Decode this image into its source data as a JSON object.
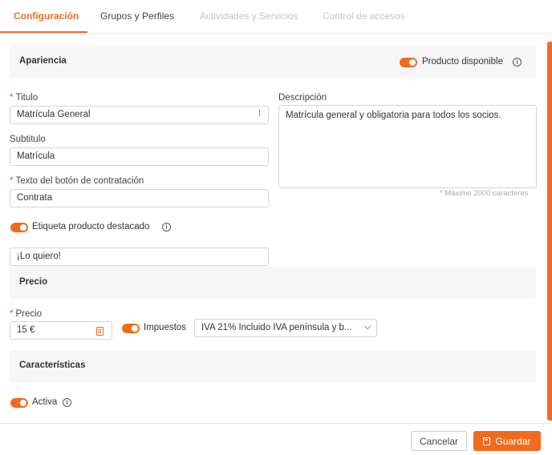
{
  "tabs": [
    {
      "label": "Configuración"
    },
    {
      "label": "Grupos y Perfiles"
    },
    {
      "label": "Actividades y Servicios"
    },
    {
      "label": "Control de accesos"
    }
  ],
  "apariencia": {
    "title": "Apariencia",
    "available_label": "Producto disponible",
    "available_on": true
  },
  "form": {
    "required_mark": "*",
    "titulo_label": "Titulo",
    "titulo_value": "Matrícula General",
    "descripcion_label": "Descripción",
    "descripcion_value": "Matrícula general y obligatoria para todos los socios.",
    "descripcion_hint": "* Máximo 2000 caracteres",
    "subtitulo_label": "Subtitulo",
    "subtitulo_value": "Matrícula",
    "boton_label": "Texto del botón de contratación",
    "boton_value": "Contrata",
    "destacado_label": "Etiqueta producto destacado",
    "destacado_on": true,
    "destacado_value": "¡Lo quiero!"
  },
  "precio": {
    "title": "Precio",
    "label": "Precio",
    "value": "15 €",
    "impuestos_label": "Impuestos",
    "impuestos_on": true,
    "impuestos_value": "IVA 21% Incluido IVA península y b..."
  },
  "caracteristicas": {
    "title": "Características",
    "activa_label": "Activa",
    "activa_on": true
  },
  "footer": {
    "cancel_label": "Cancelar",
    "save_label": "Guardar"
  },
  "colors": {
    "accent": "#f26b1d",
    "required": "#e14a3b"
  },
  "icons": {
    "info": "info-icon",
    "copy": "document-icon",
    "save": "save-icon",
    "chevron": "chevron-down-icon",
    "variable": "variable-icon"
  }
}
